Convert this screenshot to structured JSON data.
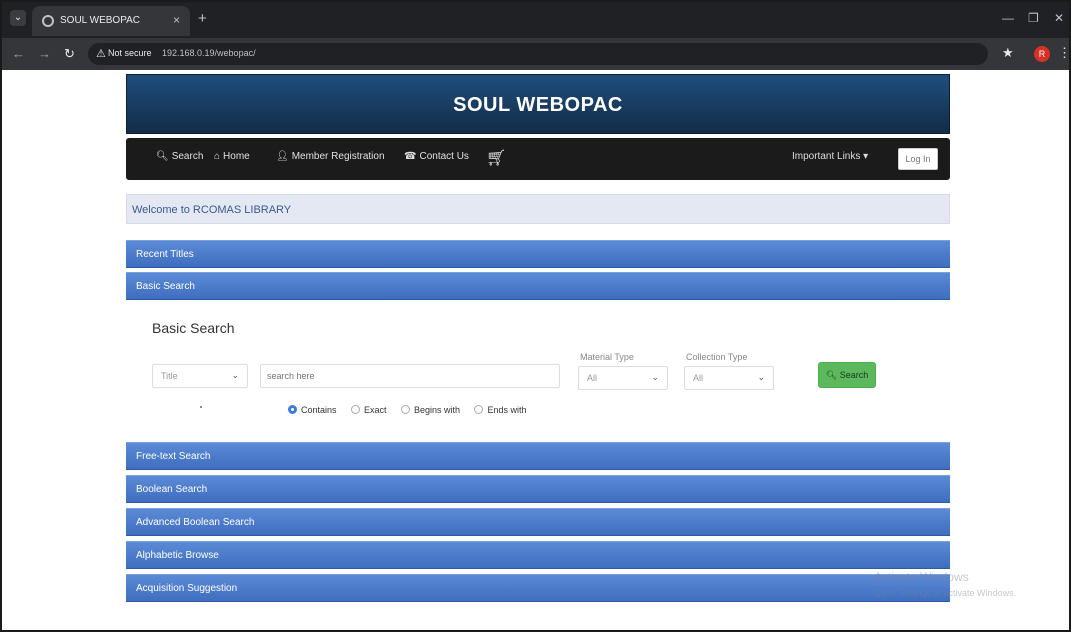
{
  "browser": {
    "tab_title": "SOUL WEBOPAC",
    "tab_close": "×",
    "new_tab": "+",
    "not_secure": "Not secure",
    "url": "192.168.0.19/webopac/",
    "profile_initial": "R"
  },
  "header": {
    "title": "SOUL WEBOPAC"
  },
  "navbar": {
    "items": [
      {
        "label": "Search",
        "icon": "search-icon"
      },
      {
        "label": "Home",
        "icon": "home-icon"
      },
      {
        "label": "Member Registration",
        "icon": "user-icon"
      },
      {
        "label": "Contact Us",
        "icon": "contact-icon"
      }
    ],
    "cart_icon": "cart-icon",
    "important_links": "Important Links",
    "login": "Log In"
  },
  "welcome": "Welcome to RCOMAS LIBRARY",
  "sections": {
    "recent_titles": "Recent Titles",
    "basic_search": "Basic Search",
    "free_text": "Free-text Search",
    "boolean": "Boolean Search",
    "advanced_boolean": "Advanced Boolean Search",
    "alphabetic": "Alphabetic Browse",
    "acquisition": "Acquisition Suggestion"
  },
  "basic_search": {
    "heading": "Basic Search",
    "field_select": "Title",
    "search_placeholder": "search here",
    "material_type_label": "Material Type",
    "material_type_value": "All",
    "collection_type_label": "Collection Type",
    "collection_type_value": "All",
    "search_button": "Search",
    "match_options": [
      "Contains",
      "Exact",
      "Begins with",
      "Ends with"
    ],
    "selected_match": "Contains"
  },
  "watermark": {
    "title": "Activate Windows",
    "subtitle": "Go to Settings to activate Windows."
  }
}
